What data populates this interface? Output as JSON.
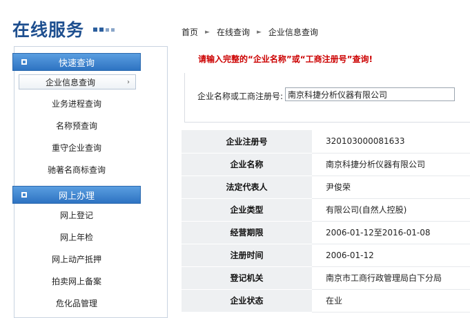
{
  "header": {
    "title": "在线服务"
  },
  "breadcrumb": [
    {
      "label": "首页"
    },
    {
      "label": "在线查询"
    },
    {
      "label": "企业信息查询"
    }
  ],
  "sidebar": {
    "sections": [
      {
        "title": "快速查询",
        "items": [
          {
            "label": "企业信息查询",
            "active": true
          },
          {
            "label": "业务进程查询"
          },
          {
            "label": "名称预查询"
          },
          {
            "label": "重守企业查询"
          },
          {
            "label": "驰著名商标查询"
          }
        ]
      },
      {
        "title": "网上办理",
        "items": [
          {
            "label": "网上登记"
          },
          {
            "label": "网上年检"
          },
          {
            "label": "网上动产抵押"
          },
          {
            "label": "拍卖网上备案"
          },
          {
            "label": "危化品管理"
          }
        ]
      }
    ]
  },
  "main": {
    "notice": "请输入完整的“企业名称”或“工商注册号”查询!",
    "search": {
      "label": "企业名称或工商注册号:",
      "value": "南京科捷分析仪器有限公司"
    },
    "results": [
      {
        "key": "企业注册号",
        "value": "320103000081633"
      },
      {
        "key": "企业名称",
        "value": "南京科捷分析仪器有限公司"
      },
      {
        "key": "法定代表人",
        "value": "尹俊荣"
      },
      {
        "key": "企业类型",
        "value": "有限公司(自然人控股)"
      },
      {
        "key": "经营期限",
        "value": "2006-01-12至2016-01-08"
      },
      {
        "key": "注册时间",
        "value": "2006-01-12"
      },
      {
        "key": "登记机关",
        "value": "南京市工商行政管理局白下分局"
      },
      {
        "key": "企业状态",
        "value": "在业"
      }
    ]
  },
  "colors": {
    "brand": "#1e4f8f",
    "notice": "#cc0000",
    "section_header": "#3c82cf"
  }
}
